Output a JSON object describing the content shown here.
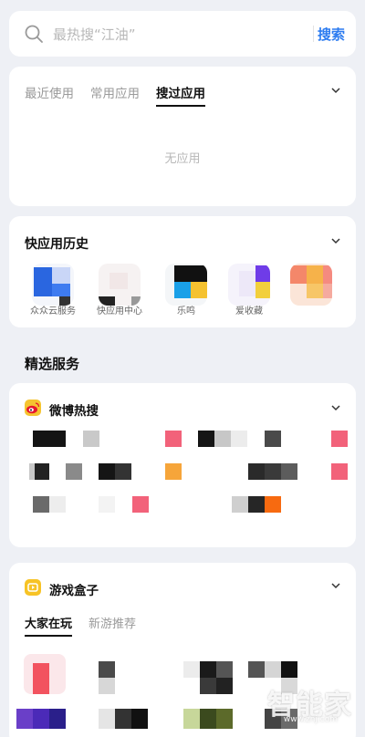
{
  "search": {
    "placeholder": "最热搜“江油”",
    "button_label": "搜索"
  },
  "apps_card": {
    "tabs": [
      {
        "label": "最近使用"
      },
      {
        "label": "常用应用"
      },
      {
        "label": "搜过应用"
      }
    ],
    "empty_text": "无应用"
  },
  "quick_apps": {
    "title": "快应用历史",
    "items": [
      {
        "label": "众众云服务"
      },
      {
        "label": "快应用中心"
      },
      {
        "label": "乐鸣"
      },
      {
        "label": "爱收藏"
      },
      {
        "label": ""
      }
    ]
  },
  "services": {
    "heading": "精选服务"
  },
  "weibo": {
    "name": "微博热搜",
    "logo_color": "#f5c430"
  },
  "game_box": {
    "name": "游戏盒子",
    "logo_color": "#f7c325",
    "tabs": [
      {
        "label": "大家在玩"
      },
      {
        "label": "新游推荐"
      }
    ]
  },
  "watermark": {
    "text": "智能家",
    "sub": "www.znj.com"
  }
}
